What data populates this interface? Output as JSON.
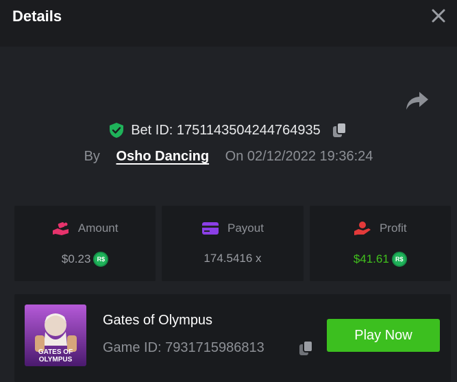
{
  "header": {
    "title": "Details",
    "close_icon": "close-icon"
  },
  "bet": {
    "id_label": "Bet ID: 1751143504244764935",
    "by_label": "By",
    "username": "Osho Dancing",
    "on_label": "On",
    "timestamp": "02/12/2022 19:36:24",
    "verified_color": "#1fb35a"
  },
  "stats": {
    "amount": {
      "label": "Amount",
      "value": "$0.23",
      "currency": "R$",
      "icon": "coins-hand-icon"
    },
    "payout": {
      "label": "Payout",
      "value": "174.5416 x",
      "icon": "card-icon"
    },
    "profit": {
      "label": "Profit",
      "value": "$41.61",
      "currency": "R$",
      "icon": "profit-hand-icon",
      "color": "#41c11d"
    }
  },
  "game": {
    "name": "Gates of Olympus",
    "id_label": "Game ID: 7931715986813",
    "thumb_text_1": "GATES OF",
    "thumb_text_2": "OLYMPUS",
    "play_label": "Play Now",
    "play_color": "#3cbf1f"
  }
}
